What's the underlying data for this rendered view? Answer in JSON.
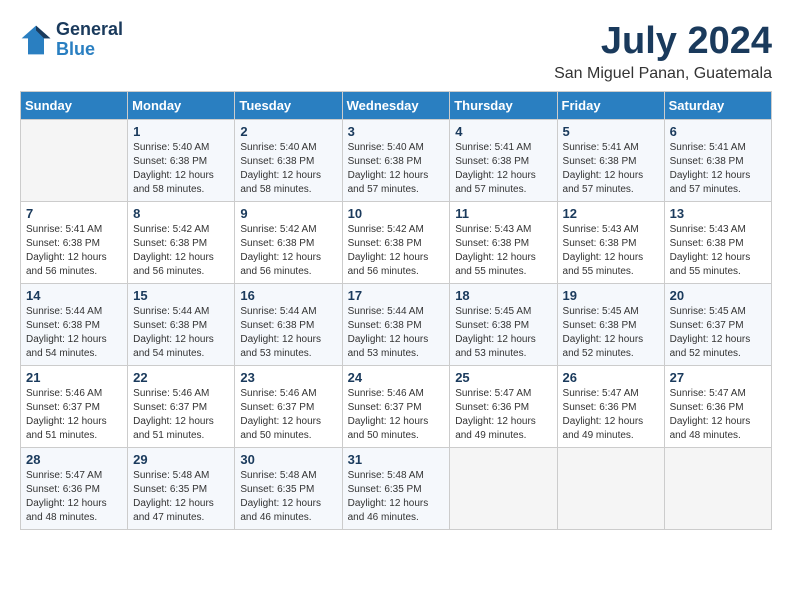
{
  "header": {
    "logo_general": "General",
    "logo_blue": "Blue",
    "title": "July 2024",
    "location": "San Miguel Panan, Guatemala"
  },
  "calendar": {
    "weekdays": [
      "Sunday",
      "Monday",
      "Tuesday",
      "Wednesday",
      "Thursday",
      "Friday",
      "Saturday"
    ],
    "weeks": [
      [
        {
          "day": "",
          "sunrise": "",
          "sunset": "",
          "daylight": ""
        },
        {
          "day": "1",
          "sunrise": "Sunrise: 5:40 AM",
          "sunset": "Sunset: 6:38 PM",
          "daylight": "Daylight: 12 hours and 58 minutes."
        },
        {
          "day": "2",
          "sunrise": "Sunrise: 5:40 AM",
          "sunset": "Sunset: 6:38 PM",
          "daylight": "Daylight: 12 hours and 58 minutes."
        },
        {
          "day": "3",
          "sunrise": "Sunrise: 5:40 AM",
          "sunset": "Sunset: 6:38 PM",
          "daylight": "Daylight: 12 hours and 57 minutes."
        },
        {
          "day": "4",
          "sunrise": "Sunrise: 5:41 AM",
          "sunset": "Sunset: 6:38 PM",
          "daylight": "Daylight: 12 hours and 57 minutes."
        },
        {
          "day": "5",
          "sunrise": "Sunrise: 5:41 AM",
          "sunset": "Sunset: 6:38 PM",
          "daylight": "Daylight: 12 hours and 57 minutes."
        },
        {
          "day": "6",
          "sunrise": "Sunrise: 5:41 AM",
          "sunset": "Sunset: 6:38 PM",
          "daylight": "Daylight: 12 hours and 57 minutes."
        }
      ],
      [
        {
          "day": "7",
          "sunrise": "Sunrise: 5:41 AM",
          "sunset": "Sunset: 6:38 PM",
          "daylight": "Daylight: 12 hours and 56 minutes."
        },
        {
          "day": "8",
          "sunrise": "Sunrise: 5:42 AM",
          "sunset": "Sunset: 6:38 PM",
          "daylight": "Daylight: 12 hours and 56 minutes."
        },
        {
          "day": "9",
          "sunrise": "Sunrise: 5:42 AM",
          "sunset": "Sunset: 6:38 PM",
          "daylight": "Daylight: 12 hours and 56 minutes."
        },
        {
          "day": "10",
          "sunrise": "Sunrise: 5:42 AM",
          "sunset": "Sunset: 6:38 PM",
          "daylight": "Daylight: 12 hours and 56 minutes."
        },
        {
          "day": "11",
          "sunrise": "Sunrise: 5:43 AM",
          "sunset": "Sunset: 6:38 PM",
          "daylight": "Daylight: 12 hours and 55 minutes."
        },
        {
          "day": "12",
          "sunrise": "Sunrise: 5:43 AM",
          "sunset": "Sunset: 6:38 PM",
          "daylight": "Daylight: 12 hours and 55 minutes."
        },
        {
          "day": "13",
          "sunrise": "Sunrise: 5:43 AM",
          "sunset": "Sunset: 6:38 PM",
          "daylight": "Daylight: 12 hours and 55 minutes."
        }
      ],
      [
        {
          "day": "14",
          "sunrise": "Sunrise: 5:44 AM",
          "sunset": "Sunset: 6:38 PM",
          "daylight": "Daylight: 12 hours and 54 minutes."
        },
        {
          "day": "15",
          "sunrise": "Sunrise: 5:44 AM",
          "sunset": "Sunset: 6:38 PM",
          "daylight": "Daylight: 12 hours and 54 minutes."
        },
        {
          "day": "16",
          "sunrise": "Sunrise: 5:44 AM",
          "sunset": "Sunset: 6:38 PM",
          "daylight": "Daylight: 12 hours and 53 minutes."
        },
        {
          "day": "17",
          "sunrise": "Sunrise: 5:44 AM",
          "sunset": "Sunset: 6:38 PM",
          "daylight": "Daylight: 12 hours and 53 minutes."
        },
        {
          "day": "18",
          "sunrise": "Sunrise: 5:45 AM",
          "sunset": "Sunset: 6:38 PM",
          "daylight": "Daylight: 12 hours and 53 minutes."
        },
        {
          "day": "19",
          "sunrise": "Sunrise: 5:45 AM",
          "sunset": "Sunset: 6:38 PM",
          "daylight": "Daylight: 12 hours and 52 minutes."
        },
        {
          "day": "20",
          "sunrise": "Sunrise: 5:45 AM",
          "sunset": "Sunset: 6:37 PM",
          "daylight": "Daylight: 12 hours and 52 minutes."
        }
      ],
      [
        {
          "day": "21",
          "sunrise": "Sunrise: 5:46 AM",
          "sunset": "Sunset: 6:37 PM",
          "daylight": "Daylight: 12 hours and 51 minutes."
        },
        {
          "day": "22",
          "sunrise": "Sunrise: 5:46 AM",
          "sunset": "Sunset: 6:37 PM",
          "daylight": "Daylight: 12 hours and 51 minutes."
        },
        {
          "day": "23",
          "sunrise": "Sunrise: 5:46 AM",
          "sunset": "Sunset: 6:37 PM",
          "daylight": "Daylight: 12 hours and 50 minutes."
        },
        {
          "day": "24",
          "sunrise": "Sunrise: 5:46 AM",
          "sunset": "Sunset: 6:37 PM",
          "daylight": "Daylight: 12 hours and 50 minutes."
        },
        {
          "day": "25",
          "sunrise": "Sunrise: 5:47 AM",
          "sunset": "Sunset: 6:36 PM",
          "daylight": "Daylight: 12 hours and 49 minutes."
        },
        {
          "day": "26",
          "sunrise": "Sunrise: 5:47 AM",
          "sunset": "Sunset: 6:36 PM",
          "daylight": "Daylight: 12 hours and 49 minutes."
        },
        {
          "day": "27",
          "sunrise": "Sunrise: 5:47 AM",
          "sunset": "Sunset: 6:36 PM",
          "daylight": "Daylight: 12 hours and 48 minutes."
        }
      ],
      [
        {
          "day": "28",
          "sunrise": "Sunrise: 5:47 AM",
          "sunset": "Sunset: 6:36 PM",
          "daylight": "Daylight: 12 hours and 48 minutes."
        },
        {
          "day": "29",
          "sunrise": "Sunrise: 5:48 AM",
          "sunset": "Sunset: 6:35 PM",
          "daylight": "Daylight: 12 hours and 47 minutes."
        },
        {
          "day": "30",
          "sunrise": "Sunrise: 5:48 AM",
          "sunset": "Sunset: 6:35 PM",
          "daylight": "Daylight: 12 hours and 46 minutes."
        },
        {
          "day": "31",
          "sunrise": "Sunrise: 5:48 AM",
          "sunset": "Sunset: 6:35 PM",
          "daylight": "Daylight: 12 hours and 46 minutes."
        },
        {
          "day": "",
          "sunrise": "",
          "sunset": "",
          "daylight": ""
        },
        {
          "day": "",
          "sunrise": "",
          "sunset": "",
          "daylight": ""
        },
        {
          "day": "",
          "sunrise": "",
          "sunset": "",
          "daylight": ""
        }
      ]
    ]
  }
}
